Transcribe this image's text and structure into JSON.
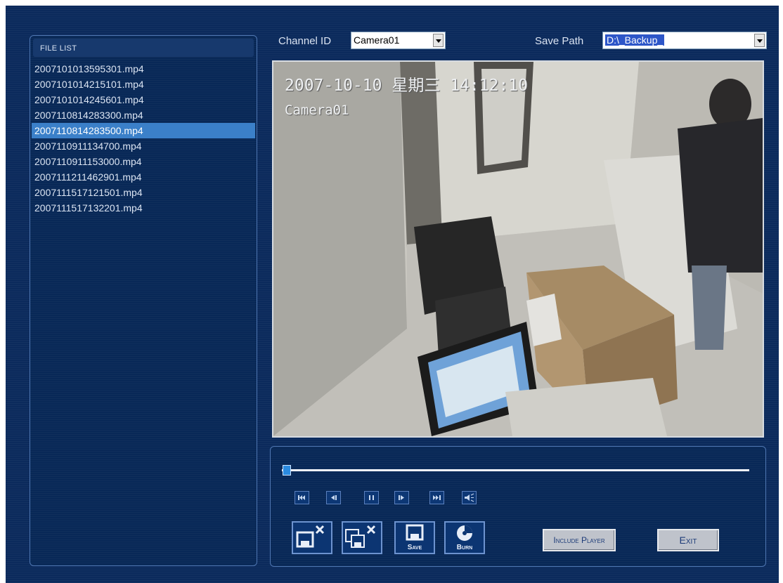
{
  "file_list": {
    "title": "FILE LIST",
    "files": [
      "2007101013595301.mp4",
      "2007101014215101.mp4",
      "2007101014245601.mp4",
      "2007110814283300.mp4",
      "2007110814283500.mp4",
      "2007110911134700.mp4",
      "2007110911153000.mp4",
      "2007111211462901.mp4",
      "2007111517121501.mp4",
      "2007111517132201.mp4"
    ],
    "selected_index": 4
  },
  "toolbar": {
    "channel_label": "Channel ID",
    "channel_value": "Camera01",
    "save_path_label": "Save Path",
    "save_path_value": "D:\\_Backup_"
  },
  "video": {
    "timestamp_date": "2007-10-10",
    "timestamp_weekday": "星期三",
    "timestamp_time": "14:12:10",
    "camera_label": "Camera01"
  },
  "playback": {
    "progress": 0.01,
    "buttons": [
      "skip-to-start-icon",
      "step-back-icon",
      "pause-icon",
      "step-forward-icon",
      "skip-to-end-icon",
      "mute-icon"
    ]
  },
  "actions": {
    "save_label": "Save",
    "burn_label": "Burn",
    "include_player_label": "Include Player",
    "exit_label": "Exit"
  },
  "colors": {
    "background": "#0b2a5c",
    "selection": "#3b80c9",
    "panel_border": "#4f77b3"
  }
}
